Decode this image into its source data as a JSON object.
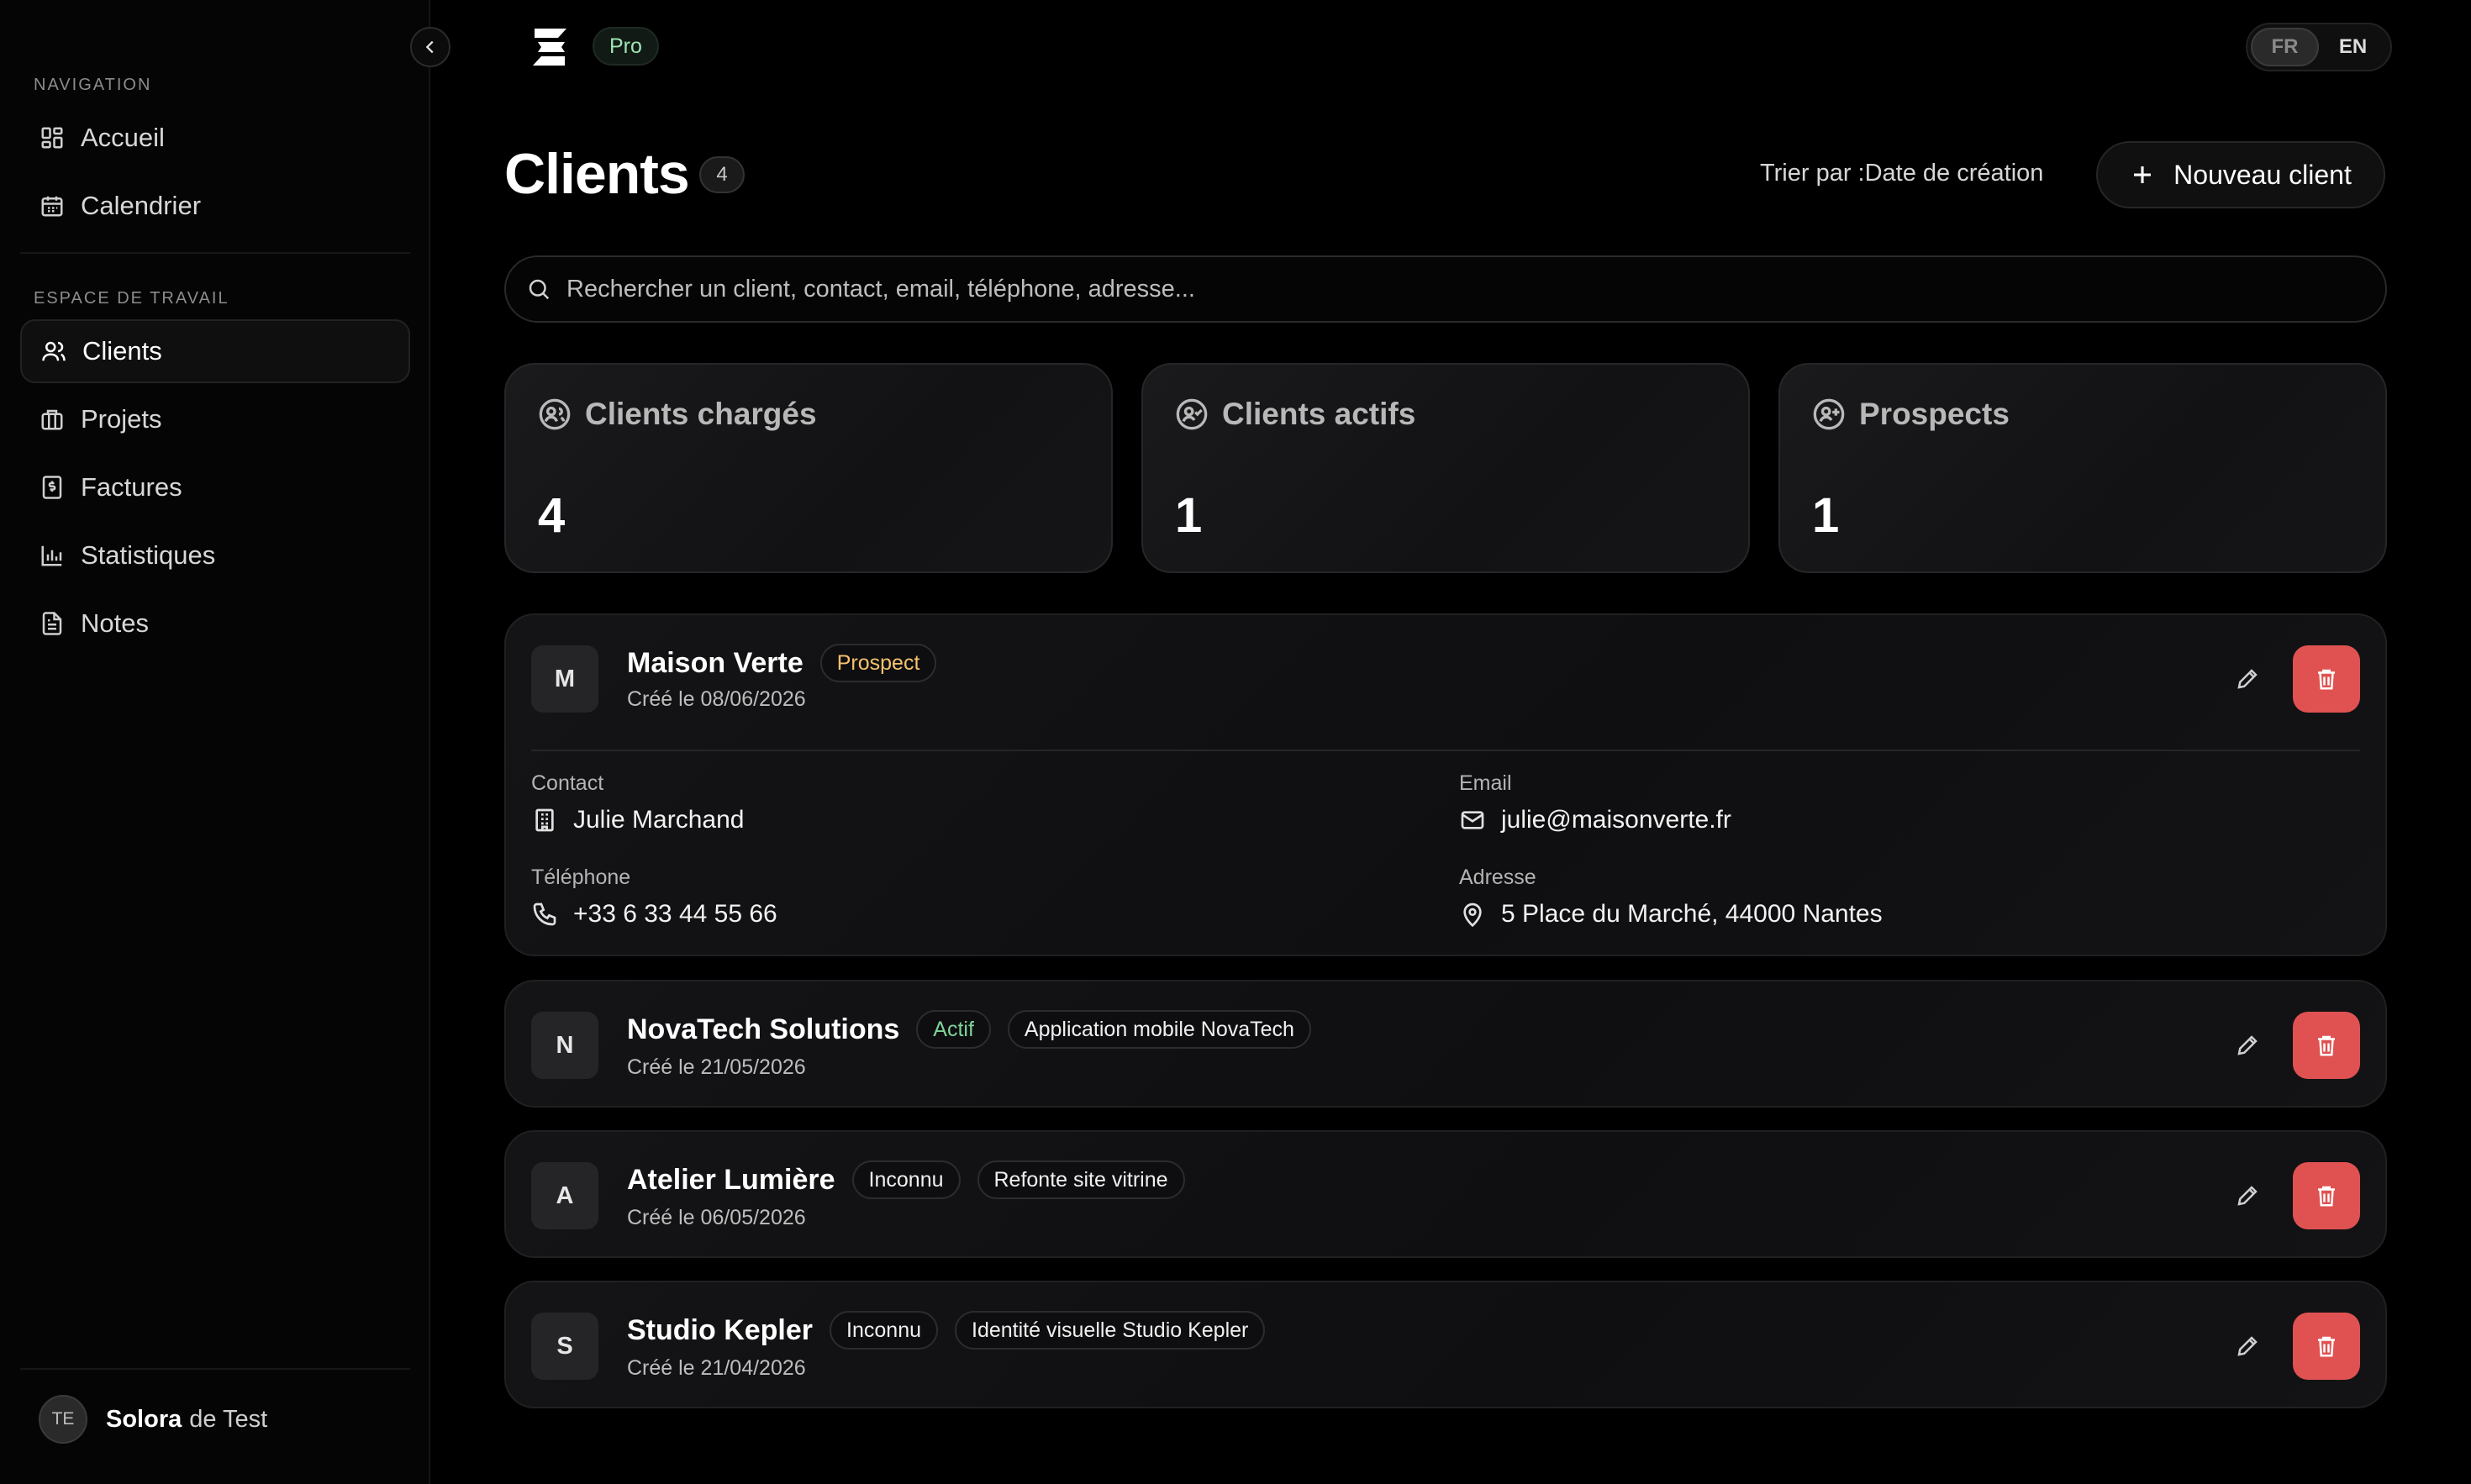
{
  "brand": {
    "plan_badge": "Pro"
  },
  "language": {
    "options": [
      "FR",
      "EN"
    ],
    "selected": "FR"
  },
  "sidebar": {
    "navigation_label": "NAVIGATION",
    "navigation_items": [
      {
        "label": "Accueil",
        "icon": "dashboard-icon"
      },
      {
        "label": "Calendrier",
        "icon": "calendar-icon"
      }
    ],
    "workspace_label": "ESPACE DE TRAVAIL",
    "workspace_items": [
      {
        "label": "Clients",
        "icon": "users-icon",
        "active": true
      },
      {
        "label": "Projets",
        "icon": "briefcase-icon"
      },
      {
        "label": "Factures",
        "icon": "invoice-icon"
      },
      {
        "label": "Statistiques",
        "icon": "bar-chart-icon"
      },
      {
        "label": "Notes",
        "icon": "note-icon"
      }
    ],
    "user": {
      "initials": "TE",
      "first_name": "Solora",
      "last_name": "de Test"
    }
  },
  "header": {
    "title": "Clients",
    "count": "4",
    "sort_label": "Trier par :Date de création",
    "new_client_label": "Nouveau client"
  },
  "search": {
    "placeholder": "Rechercher un client, contact, email, téléphone, adresse..."
  },
  "stats": [
    {
      "label": "Clients chargés",
      "value": "4",
      "icon": "users-circle-icon"
    },
    {
      "label": "Clients actifs",
      "value": "1",
      "icon": "user-check-icon"
    },
    {
      "label": "Prospects",
      "value": "1",
      "icon": "user-plus-icon"
    }
  ],
  "clients": [
    {
      "initial": "M",
      "name": "Maison Verte",
      "status": "Prospect",
      "status_color": "#f5c26b",
      "project": "",
      "created": "Créé le 08/06/2026",
      "details": {
        "contact_label": "Contact",
        "contact": "Julie Marchand",
        "email_label": "Email",
        "email": "julie@maisonverte.fr",
        "phone_label": "Téléphone",
        "phone": "+33 6 33 44 55 66",
        "address_label": "Adresse",
        "address": "5 Place du Marché, 44000 Nantes"
      }
    },
    {
      "initial": "N",
      "name": "NovaTech Solutions",
      "status": "Actif",
      "status_color": "#7fd49a",
      "project": "Application mobile NovaTech",
      "created": "Créé le 21/05/2026"
    },
    {
      "initial": "A",
      "name": "Atelier Lumière",
      "status": "Inconnu",
      "status_color": "#f0f0f0",
      "project": "Refonte site vitrine",
      "created": "Créé le 06/05/2026"
    },
    {
      "initial": "S",
      "name": "Studio Kepler",
      "status": "Inconnu",
      "status_color": "#f0f0f0",
      "project": "Identité visuelle Studio Kepler",
      "created": "Créé le 21/04/2026"
    }
  ],
  "colors": {
    "accent_delete": "#e05252",
    "background": "#000000",
    "pro_badge_text": "#9ee6b2"
  }
}
